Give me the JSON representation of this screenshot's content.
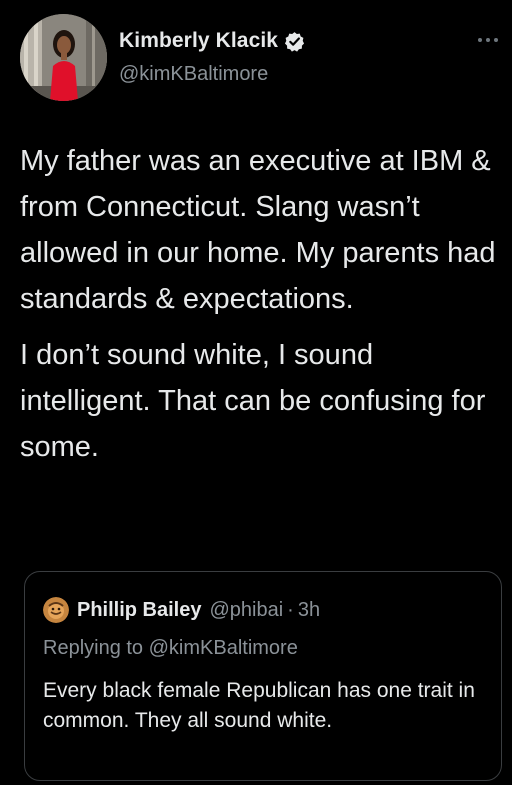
{
  "tweet": {
    "author": {
      "display_name": "Kimberly Klacik",
      "handle": "@kimKBaltimore",
      "verified": true
    },
    "paragraphs": [
      "My father was an executive at IBM & from Connecticut. Slang wasn’t allowed in our home. My parents had standards & expectations.",
      "I don’t sound white, I sound intelligent. That can be confusing for some."
    ]
  },
  "quoted_tweet": {
    "display_name": "Phillip Bailey",
    "handle": "@phibai",
    "separator": "·",
    "time": "3h",
    "replying_to": "Replying to @kimKBaltimore",
    "text": "Every black female Republican has one trait in common. They all sound white."
  },
  "icons": {
    "verified": "verified-badge-icon",
    "more": "more-options-icon"
  },
  "colors": {
    "background": "#000000",
    "primary_text": "#e7e9ea",
    "secondary_text": "#8b9298",
    "card_border": "#3a3d40"
  }
}
